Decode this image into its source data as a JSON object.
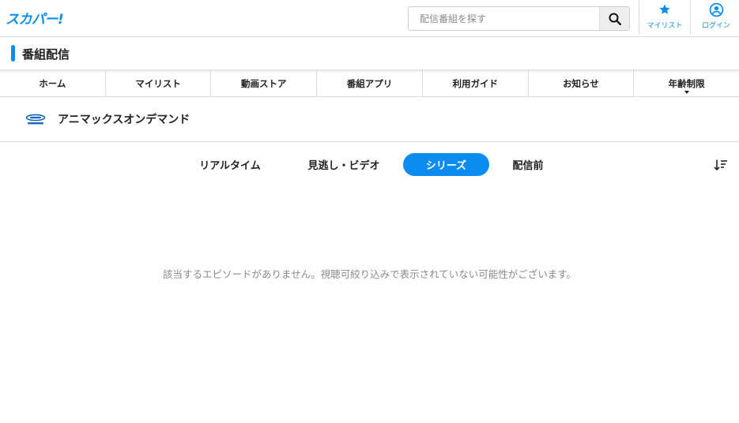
{
  "header": {
    "logo": "スカパー!",
    "search": {
      "placeholder": "配信番組を探す",
      "value": ""
    },
    "mylist_label": "マイリスト",
    "login_label": "ログイン"
  },
  "page": {
    "title": "番組配信"
  },
  "nav": {
    "items": [
      "ホーム",
      "マイリスト",
      "動画ストア",
      "番組アプリ",
      "利用ガイド",
      "お知らせ",
      "年齢制限"
    ]
  },
  "channel": {
    "name": "アニマックスオンデマンド"
  },
  "tabs": {
    "items": [
      "リアルタイム",
      "見逃し・ビデオ",
      "シリーズ",
      "配信前"
    ],
    "active": "シリーズ"
  },
  "content": {
    "empty_message": "該当するエピソードがありません。視聴可絞り込みで表示されていない可能性がございます。"
  },
  "colors": {
    "accent": "#0a8cf0",
    "text": "#222222",
    "muted": "#8a8a8a"
  },
  "icons": [
    "search-icon",
    "star-icon",
    "user-circle-icon",
    "sort-icon",
    "channel-logo-icon",
    "chevron-down-icon"
  ]
}
